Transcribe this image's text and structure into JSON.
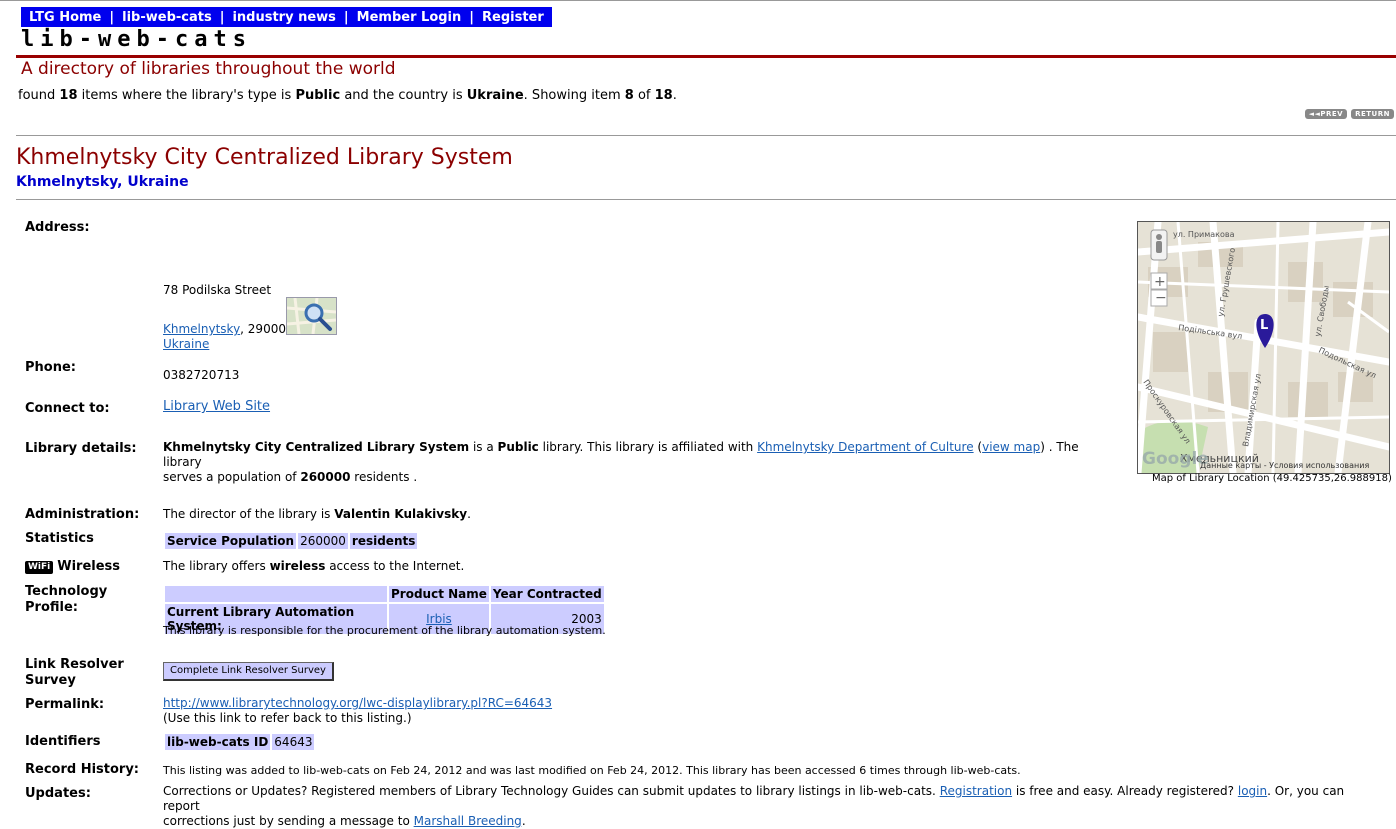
{
  "nav": {
    "items": [
      "LTG Home",
      "lib-web-cats",
      "industry news",
      "Member Login",
      "Register"
    ]
  },
  "logo": "lib-web-cats",
  "tagline": "A directory of libraries throughout the world",
  "found": {
    "prefix": "found",
    "count": "18",
    "mid1": "items where the library's type is",
    "type": "Public",
    "mid2": "and the country is",
    "country": "Ukraine",
    "mid3": ". Showing item",
    "item": "8",
    "of": "of",
    "total": "18",
    "end": "."
  },
  "pager": {
    "prev": "◄◄PREV",
    "return": "RETURN"
  },
  "library": {
    "name": "Khmelnytsky City Centralized Library System",
    "location": "Khmelnytsky, Ukraine"
  },
  "address": {
    "label": "Address:",
    "street": "78 Podilska Street",
    "city": "Khmelnytsky",
    "postal": ", 29000",
    "country": "Ukraine"
  },
  "phone": {
    "label": "Phone:",
    "value": "0382720713"
  },
  "connect": {
    "label": "Connect to:",
    "link": "Library Web Site"
  },
  "details": {
    "label": "Library details:",
    "name": "Khmelnytsky City Centralized Library System",
    "is_a": "is a",
    "type": "Public",
    "affiliated": "library. This library is affiliated with",
    "affiliate": "Khmelnytsky Department of Culture",
    "open_paren": "(",
    "view_map": "view map",
    "after": ") . The library",
    "line2": "serves a population of",
    "population": "260000",
    "residents": "residents ."
  },
  "administration": {
    "label": "Administration:",
    "prefix": "The director of the library is",
    "director": "Valentin Kulakivsky",
    "end": "."
  },
  "statistics": {
    "label": "Statistics",
    "col1": "Service Population",
    "value": "260000",
    "col3": "residents"
  },
  "wireless": {
    "badge": "WiFi",
    "label": "Wireless",
    "prefix": "The library offers",
    "bold": "wireless",
    "suffix": "access to the Internet."
  },
  "technology": {
    "label": "Technology Profile:",
    "header_product": "Product Name",
    "header_year": "Year Contracted",
    "row_label": "Current Library Automation System:",
    "product": "Irbis",
    "year": "2003",
    "note": "This library is responsible for the procurement of the library automation system."
  },
  "link_resolver": {
    "label": "Link Resolver Survey",
    "button": "Complete Link Resolver Survey"
  },
  "permalink": {
    "label": "Permalink:",
    "url": "http://www.librarytechnology.org/lwc-displaylibrary.pl?RC=64643",
    "note": "(Use this link to refer back to this listing.)"
  },
  "identifiers": {
    "label": "Identifiers",
    "name": "lib-web-cats ID",
    "value": "64643"
  },
  "history": {
    "label": "Record History:",
    "text": "This listing was added to lib-web-cats on Feb 24, 2012 and was last modified on Feb 24, 2012. This library has been accessed 6 times through lib-web-cats."
  },
  "updates": {
    "label": "Updates:",
    "text1": "Corrections or Updates? Registered members of Library Technology Guides can submit updates to library listings in lib-web-cats.",
    "registration": "Registration",
    "text2": "is free and easy. Already registered?",
    "login": "login",
    "text3": ". Or, you can report",
    "text4": "corrections just by sending a message to",
    "marshall": "Marshall Breeding",
    "end": "."
  },
  "map": {
    "caption": "Map of Library Location (49.425735,26.988918)",
    "attribution": "Данные карты - Условия использования",
    "google": "Google",
    "streets": [
      "ул. Примакова",
      "Подільська вул",
      "ул. Свободы",
      "Подольская ул",
      "Владимирская ул",
      "Проскуровская ул",
      "ул. Грушевского",
      "Хмельницкий"
    ]
  }
}
